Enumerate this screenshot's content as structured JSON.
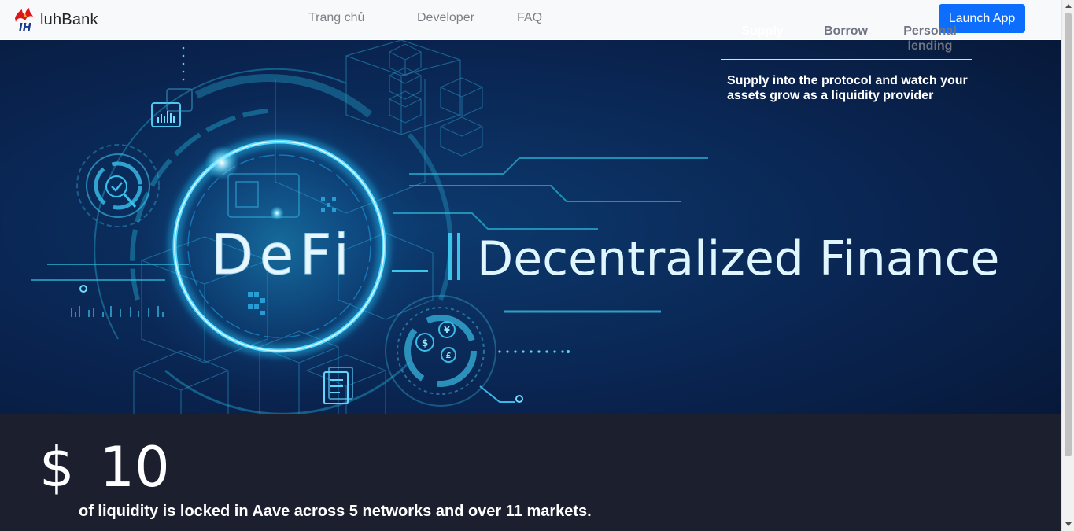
{
  "navbar": {
    "brand_name": "luhBank",
    "links": [
      "Trang chủ",
      "Developer",
      "FAQ"
    ],
    "launch_button": "Launch App"
  },
  "hero": {
    "defi_text": "DeFi",
    "headline": "Decentralized Finance"
  },
  "stats": {
    "currency": "$",
    "amount": "10",
    "description": "of liquidity is locked in Aave across 5 networks and over 11 markets."
  },
  "tabs": {
    "items": [
      "Supply",
      "Borrow",
      "Personal lending"
    ],
    "active": "Supply",
    "description": "Supply into the protocol and watch your assets grow as a liquidity provider"
  },
  "colors": {
    "accent": "#0d6efd",
    "hero_bg": "#0a2450",
    "hero_glow": "#1fc8ff",
    "stats_bg": "#1c1f2e"
  },
  "icons": [
    "logo-icon",
    "chart-icon",
    "check-icon",
    "magnifier-icon",
    "dollar-icon",
    "yen-icon",
    "document-icon"
  ]
}
